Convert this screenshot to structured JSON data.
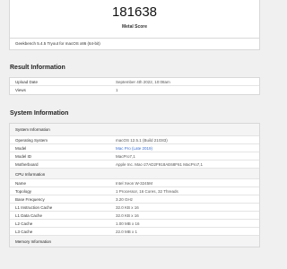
{
  "score": {
    "value": "181638",
    "label": "Metal Score"
  },
  "build": {
    "text": "Geekbench 5.4.5 Tryout for macOS x86 (64-bit)"
  },
  "result_info": {
    "title": "Result Information",
    "rows": [
      {
        "label": "Upload Date",
        "value": "September 4th 2022, 10:08am"
      },
      {
        "label": "Views",
        "value": "1"
      }
    ]
  },
  "system_info": {
    "title": "System Information",
    "header": "System Information",
    "rows": [
      {
        "label": "Operating System",
        "value": "macOS 12.5.1 (Build 21G83)"
      },
      {
        "label": "Model",
        "value": "Mac Pro (Late 2019)"
      },
      {
        "label": "Model ID",
        "value": "MacPro7,1"
      },
      {
        "label": "Motherboard",
        "value": "Apple Inc. Mac-27AD2F918AE68F61 MacPro7,1"
      }
    ],
    "cpu_header": "CPU Information",
    "cpu_rows": [
      {
        "label": "Name",
        "value": "Intel Xeon W-3245M"
      },
      {
        "label": "Topology",
        "value": "1 Processor, 16 Cores, 32 Threads"
      },
      {
        "label": "Base Frequency",
        "value": "3.20 GHz"
      },
      {
        "label": "L1 Instruction Cache",
        "value": "32.0 KB x 16"
      },
      {
        "label": "L1 Data Cache",
        "value": "32.0 KB x 16"
      },
      {
        "label": "L2 Cache",
        "value": "1.00 MB x 16"
      },
      {
        "label": "L3 Cache",
        "value": "22.0 MB x 1"
      }
    ],
    "memory_header": "Memory Information"
  },
  "colors": {
    "background": "#f0f0f1",
    "card": "#ffffff",
    "link": "#3b6fd0"
  }
}
